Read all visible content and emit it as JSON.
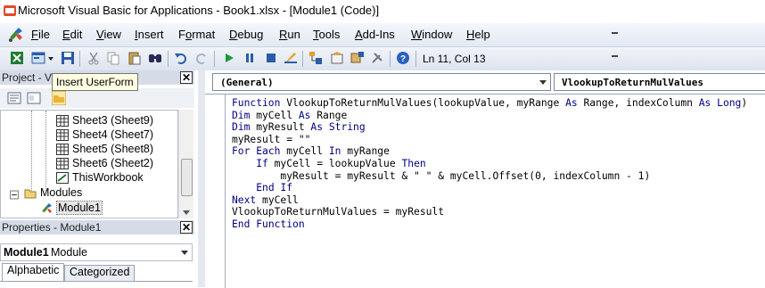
{
  "window": {
    "title": "Microsoft Visual Basic for Applications - Book1.xlsx - [Module1 (Code)]"
  },
  "menu": {
    "items": [
      {
        "label": "File",
        "key": "F",
        "rest": "ile"
      },
      {
        "label": "Edit",
        "key": "E",
        "rest": "dit"
      },
      {
        "label": "View",
        "key": "V",
        "rest": "iew"
      },
      {
        "label": "Insert",
        "key": "I",
        "rest": "nsert"
      },
      {
        "label": "Format",
        "key": "o",
        "pre": "F",
        "rest": "rmat"
      },
      {
        "label": "Debug",
        "key": "D",
        "rest": "ebug"
      },
      {
        "label": "Run",
        "key": "R",
        "rest": "un"
      },
      {
        "label": "Tools",
        "key": "T",
        "rest": "ools"
      },
      {
        "label": "Add-Ins",
        "key": "A",
        "rest": "dd-Ins"
      },
      {
        "label": "Window",
        "key": "W",
        "rest": "indow"
      },
      {
        "label": "Help",
        "key": "H",
        "rest": "elp"
      }
    ]
  },
  "toolbar": {
    "position_text": "Ln 11, Col 13",
    "tooltip": "Insert UserForm",
    "icons": [
      "excel-icon",
      "insert-userform-icon",
      "cut-icon",
      "copy-icon",
      "paste-icon",
      "find-icon",
      "undo-icon",
      "redo-icon",
      "run-icon",
      "break-icon",
      "reset-icon",
      "design-mode-icon",
      "project-explorer-icon",
      "properties-icon",
      "object-browser-icon",
      "toolbox-icon",
      "help-icon"
    ]
  },
  "project": {
    "header": "Project - VBAProject",
    "header_visible": "Project - VI",
    "tree": [
      {
        "label": "Sheet3 (Sheet9)",
        "type": "sheet"
      },
      {
        "label": "Sheet4 (Sheet7)",
        "type": "sheet"
      },
      {
        "label": "Sheet5 (Sheet8)",
        "type": "sheet"
      },
      {
        "label": "Sheet6 (Sheet2)",
        "type": "sheet"
      },
      {
        "label": "ThisWorkbook",
        "type": "workbook"
      },
      {
        "label": "Modules",
        "type": "folder"
      },
      {
        "label": "Module1",
        "type": "module",
        "selected": true
      }
    ]
  },
  "properties": {
    "header": "Properties - Module1",
    "object_name": "Module1",
    "object_type": "Module",
    "tabs": [
      "Alphabetic",
      "Categorized"
    ]
  },
  "code": {
    "object_combo": "(General)",
    "procedure_combo": "VlookupToReturnMulValues",
    "lines": [
      "Function VlookupToReturnMulValues(lookupValue, myRange As Range, indexColumn As Long)",
      "Dim myCell As Range",
      "Dim myResult As String",
      "myResult = \"\"",
      "For Each myCell In myRange",
      "    If myCell = lookupValue Then",
      "        myResult = myResult & \" \" & myCell.Offset(0, indexColumn - 1)",
      "    End If",
      "Next myCell",
      "VlookupToReturnMulValues = myResult",
      "End Function"
    ]
  },
  "colors": {
    "keyword": "#000080",
    "menu_bg": "#e3e9f3",
    "tooltip_bg": "#ffffe1"
  }
}
